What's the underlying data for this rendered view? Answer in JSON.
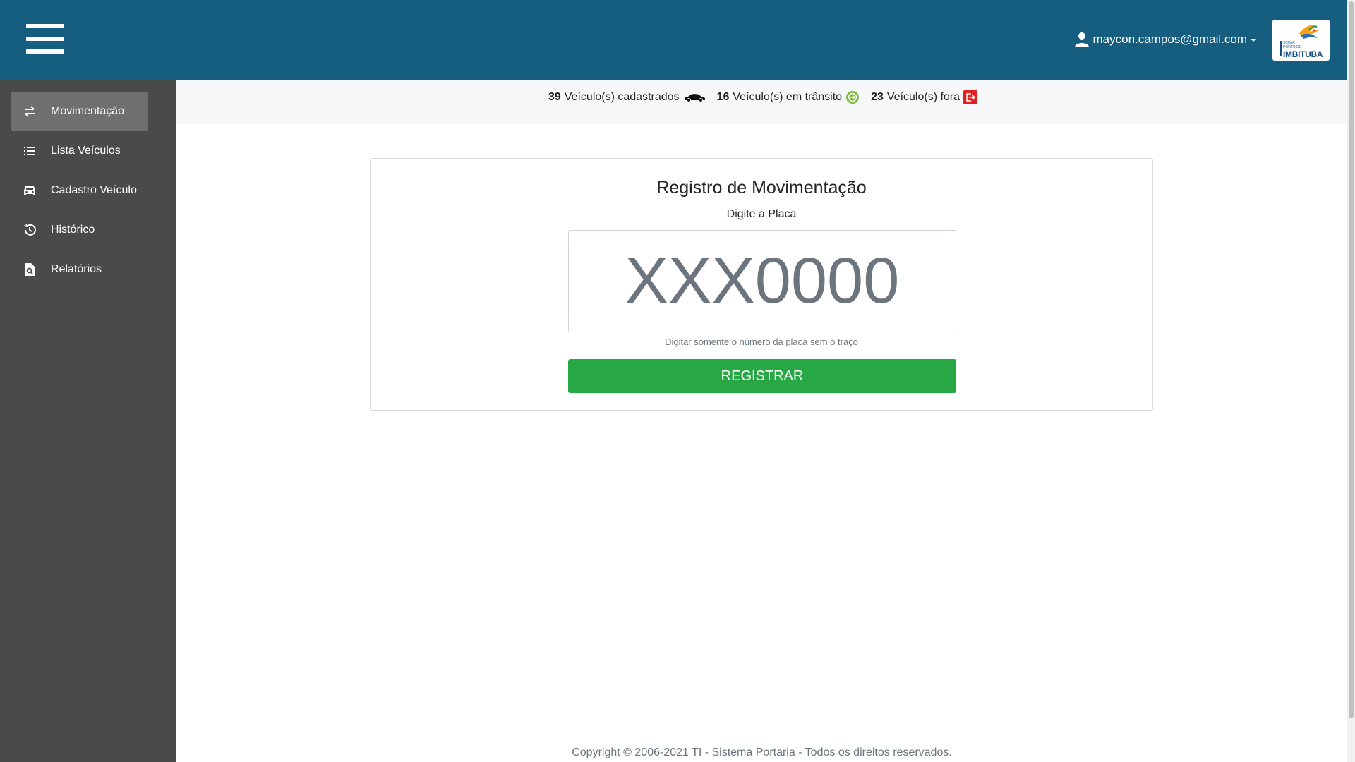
{
  "header": {
    "user_email": "maycon.campos@gmail.com",
    "logo": {
      "small_text": "SCPAR",
      "small_text2": "PORTO DE",
      "name": "IMBITUBA"
    }
  },
  "sidebar": {
    "items": [
      {
        "label": "Movimentação",
        "icon": "swap-arrows-icon",
        "active": true
      },
      {
        "label": "Lista Veículos",
        "icon": "list-icon",
        "active": false
      },
      {
        "label": "Cadastro Veículo",
        "icon": "car-icon",
        "active": false
      },
      {
        "label": "Histórico",
        "icon": "history-icon",
        "active": false
      },
      {
        "label": "Relatórios",
        "icon": "report-search-icon",
        "active": false
      }
    ]
  },
  "stats": {
    "registered_count": "39",
    "registered_label": "Veículo(s) cadastrados",
    "transit_count": "16",
    "transit_label": "Veículo(s) em trânsito",
    "outside_count": "23",
    "outside_label": "Veículo(s) fora"
  },
  "form": {
    "title": "Registro de Movimentação",
    "subtitle": "Digite a Placa",
    "plate_placeholder": "XXX0000",
    "plate_value": "",
    "hint": "Digitar somente o número da placa sem o traço",
    "submit_label": "REGISTRAR"
  },
  "footer": {
    "copyright": "Copyright © 2006-2021 TI - Sistema Portaria - Todos os direitos reservados."
  },
  "colors": {
    "header_bg": "#155e80",
    "sidebar_bg": "#4a4a4a",
    "sidebar_active": "#6f6f6f",
    "button_green": "#28a745",
    "transit_icon": "#7dbb3c",
    "outside_icon": "#e41f1f"
  }
}
